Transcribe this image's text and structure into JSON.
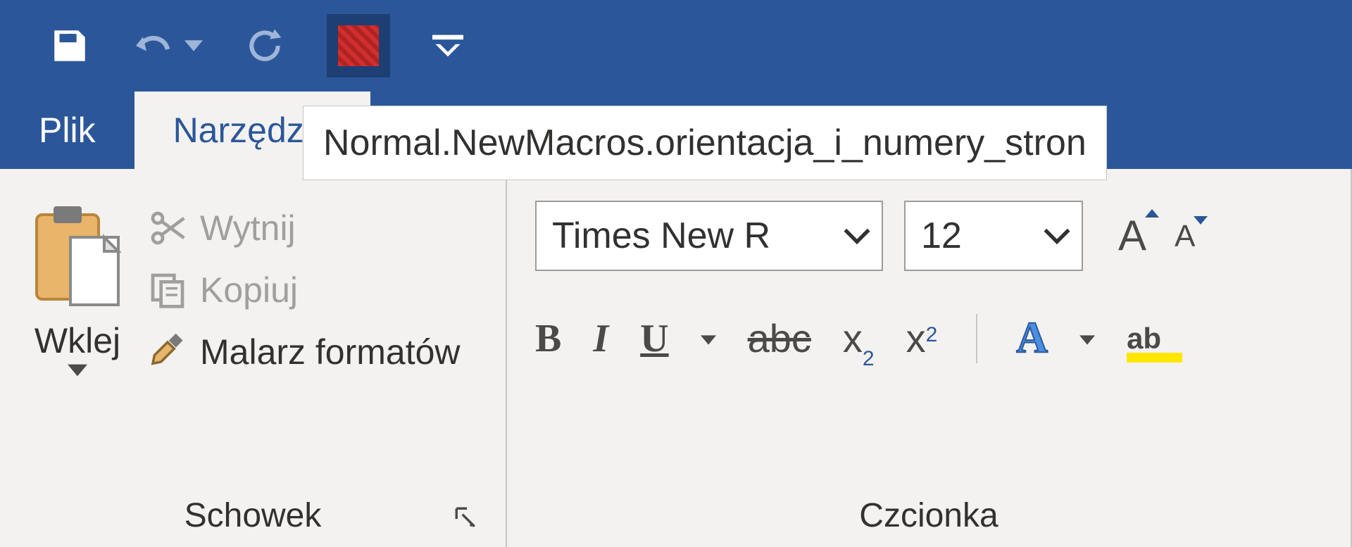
{
  "qat": {
    "save": "save",
    "undo": "undo",
    "repeat": "repeat",
    "macro_tooltip": "Normal.NewMacros.orientacja_i_numery_stron"
  },
  "tabs": {
    "file": "Plik",
    "active": "Narzędzia"
  },
  "clipboard": {
    "paste": "Wklej",
    "cut": "Wytnij",
    "copy": "Kopiuj",
    "format_painter": "Malarz formatów",
    "group_label": "Schowek"
  },
  "font": {
    "family": "Times New R",
    "size": "12",
    "group_label": "Czcionka",
    "bold": "B",
    "italic": "I",
    "underline": "U",
    "strike": "abc",
    "subscript_base": "x",
    "subscript_digit": "2",
    "superscript_base": "x",
    "superscript_digit": "2",
    "text_effects": "A",
    "highlight_text": "ab",
    "increase_A": "A",
    "decrease_A": "A"
  }
}
